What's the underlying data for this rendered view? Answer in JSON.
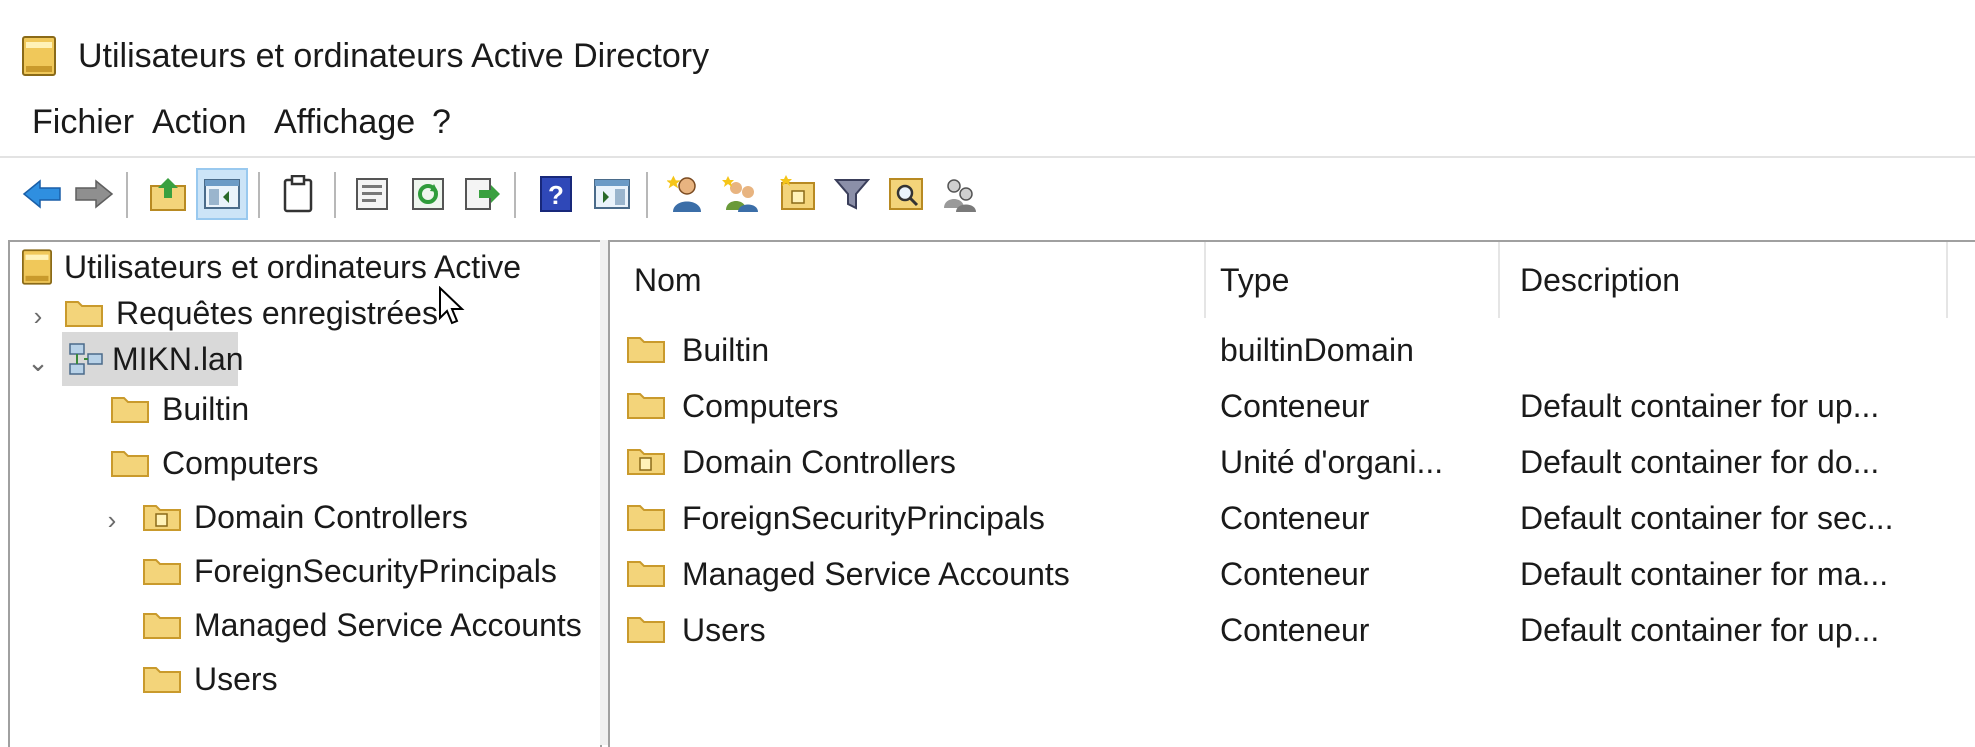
{
  "window": {
    "title": "Utilisateurs et ordinateurs Active Directory",
    "icon": "ad-users-computers-icon"
  },
  "menu": {
    "items": [
      "Fichier",
      "Action",
      "Affichage",
      "?"
    ]
  },
  "toolbar": {
    "buttons": [
      {
        "name": "back-arrow-icon"
      },
      {
        "name": "forward-arrow-icon"
      },
      {
        "name": "up-folder-icon"
      },
      {
        "name": "show-hide-console-tree-icon",
        "active": true
      },
      {
        "name": "clipboard-icon"
      },
      {
        "name": "properties-icon"
      },
      {
        "name": "refresh-icon"
      },
      {
        "name": "export-list-icon"
      },
      {
        "name": "help-icon"
      },
      {
        "name": "show-hide-action-pane-icon"
      },
      {
        "name": "new-user-icon"
      },
      {
        "name": "new-group-icon"
      },
      {
        "name": "new-ou-icon"
      },
      {
        "name": "filter-icon"
      },
      {
        "name": "find-icon"
      },
      {
        "name": "add-to-group-icon"
      }
    ]
  },
  "tree": {
    "root": "Utilisateurs et ordinateurs Active",
    "saved_queries": "Requêtes enregistrées",
    "domain": "MIKN.lan",
    "children": [
      {
        "label": "Builtin",
        "type": "folder",
        "expandable": false
      },
      {
        "label": "Computers",
        "type": "folder",
        "expandable": false
      },
      {
        "label": "Domain Controllers",
        "type": "ou",
        "expandable": true
      },
      {
        "label": "ForeignSecurityPrincipals",
        "type": "folder",
        "expandable": false
      },
      {
        "label": "Managed Service Accounts",
        "type": "folder",
        "expandable": false
      },
      {
        "label": "Users",
        "type": "folder",
        "expandable": false
      }
    ]
  },
  "list": {
    "columns": [
      "Nom",
      "Type",
      "Description"
    ],
    "rows": [
      {
        "name": "Builtin",
        "type": "builtinDomain",
        "description": "",
        "icon": "folder"
      },
      {
        "name": "Computers",
        "type": "Conteneur",
        "description": "Default container for up...",
        "icon": "folder"
      },
      {
        "name": "Domain Controllers",
        "type": "Unité d'organi...",
        "description": "Default container for do...",
        "icon": "ou"
      },
      {
        "name": "ForeignSecurityPrincipals",
        "type": "Conteneur",
        "description": "Default container for sec...",
        "icon": "folder"
      },
      {
        "name": "Managed Service Accounts",
        "type": "Conteneur",
        "description": "Default container for ma...",
        "icon": "folder"
      },
      {
        "name": "Users",
        "type": "Conteneur",
        "description": "Default container for up...",
        "icon": "folder"
      }
    ]
  },
  "colors": {
    "folder": "#f3d47a",
    "folder_dark": "#d9a93a",
    "selection": "#d9d9d9",
    "toolbar_active": "#cce4f7"
  }
}
